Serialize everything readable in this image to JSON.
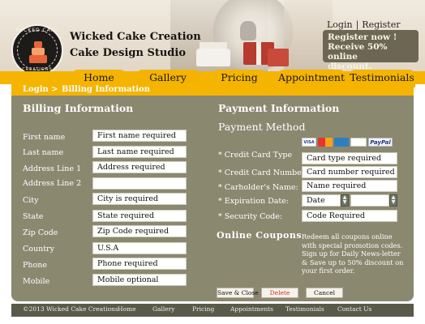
{
  "header": {
    "brand_line1": "Wicked Cake Creation",
    "brand_line2": "Cake Design Studio",
    "logo_top_text": "WICKED CAKE",
    "logo_bottom_text": "CREATIONS",
    "login": "Login",
    "separator": "|",
    "register": "Register",
    "promo": [
      "Register now !",
      "Receive  50% online",
      "discount."
    ]
  },
  "nav": {
    "tabs": [
      "Home",
      "Gallery",
      "Pricing",
      "Appointment",
      "Testimonials"
    ],
    "active_tab": "Gallery",
    "breadcrumb": [
      "Login >",
      "Billing Information"
    ]
  },
  "billing": {
    "heading": "Billing Information",
    "fields": [
      {
        "label": "First name",
        "value": "First name required"
      },
      {
        "label": "Last name",
        "value": "Last name required"
      },
      {
        "label": "Address Line 1",
        "value": "Address required"
      },
      {
        "label": "Address Line 2",
        "value": ""
      },
      {
        "label": "City",
        "value": "City is required"
      },
      {
        "label": "State",
        "value": "State required"
      },
      {
        "label": "Zip Code",
        "value": "Zip Code required"
      },
      {
        "label": "Country",
        "value": "U.S.A"
      },
      {
        "label": "Phone",
        "value": "Phone required"
      },
      {
        "label": "Mobile",
        "value": "Mobile optional"
      }
    ]
  },
  "payment": {
    "heading": "Payment Information",
    "method_label": "Payment Method",
    "card_icons": [
      "VISA",
      "MasterCard",
      "AMEX",
      "DISCOVER",
      "PayPal"
    ],
    "fields": [
      {
        "label": "* Credit Card Type",
        "value": "Card type required"
      },
      {
        "label": "* Credit Card Number",
        "value": "Card number required"
      },
      {
        "label": "* Carholder's Name:",
        "value": "Name required"
      },
      {
        "label": "* Expiration Date:",
        "value": "Date"
      },
      {
        "label": "* Security Code:",
        "value": "Code Required"
      }
    ]
  },
  "coupons": {
    "title": "Online  Coupons",
    "text": "Redeem all coupons online with special promotion codes. Sign up  for  Daily News-letter & Save up to 50% discount on your first order."
  },
  "buttons": {
    "save": "Save & Close",
    "delete": "Delete",
    "cancel": "Cancel"
  },
  "footer": {
    "copyright": "©2013 Wicked Cake Creations",
    "links": [
      "Home",
      "Gallery",
      "Pricing",
      "Appointments",
      "Testimonials",
      "Contact Us"
    ]
  },
  "colors": {
    "accent": "#f4b400",
    "panel": "#8b8870",
    "footer": "#5a5a4a",
    "promo": "#6d6652"
  }
}
